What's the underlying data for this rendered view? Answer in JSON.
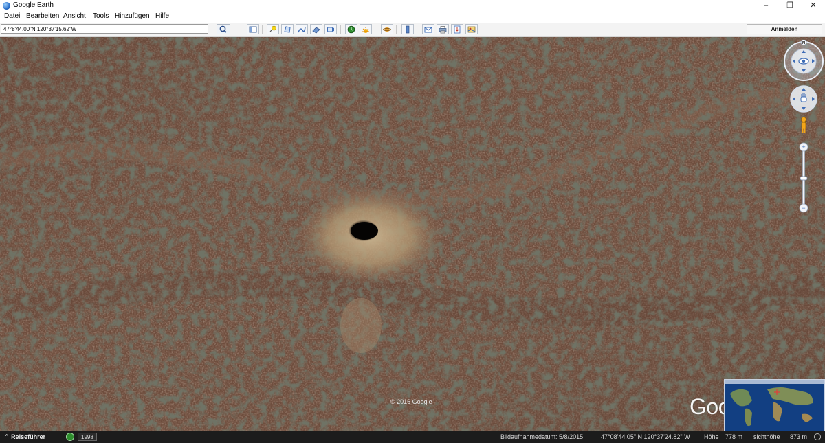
{
  "window": {
    "title": "Google Earth",
    "minimize": "–",
    "maximize": "❐",
    "close": "✕"
  },
  "menu": [
    {
      "label": "Datei"
    },
    {
      "label": "Bearbeiten"
    },
    {
      "label": "Ansicht"
    },
    {
      "label": "Tools"
    },
    {
      "label": "Hinzufügen"
    },
    {
      "label": "Hilfe"
    }
  ],
  "toolbar": {
    "search_value": "47°8'44.00\"N 120°37'15.62\"W",
    "login_label": "Anmelden"
  },
  "map": {
    "copyright": "© 2016 Google",
    "watermark": "Google Earth"
  },
  "nav": {
    "north_label": "N",
    "zoom_in": "+",
    "zoom_out": "−"
  },
  "statusbar": {
    "tour_guide": "Reiseführer",
    "history_year": "1998",
    "imagery_date": "Bildaufnahmedatum: 5/8/2015",
    "coordinates": "47°08'44.05\" N  120°37'24.82\" W",
    "elevation_label": "Höhe",
    "elevation_value": "778 m",
    "eye_alt_label": "sichthöhe",
    "eye_alt_value": "873 m"
  },
  "colors": {
    "terrain": "#6b4a3a",
    "statusbar": "#1c1c1c",
    "toolbar": "#f3f3f3",
    "accent": "#2a6fc9"
  }
}
